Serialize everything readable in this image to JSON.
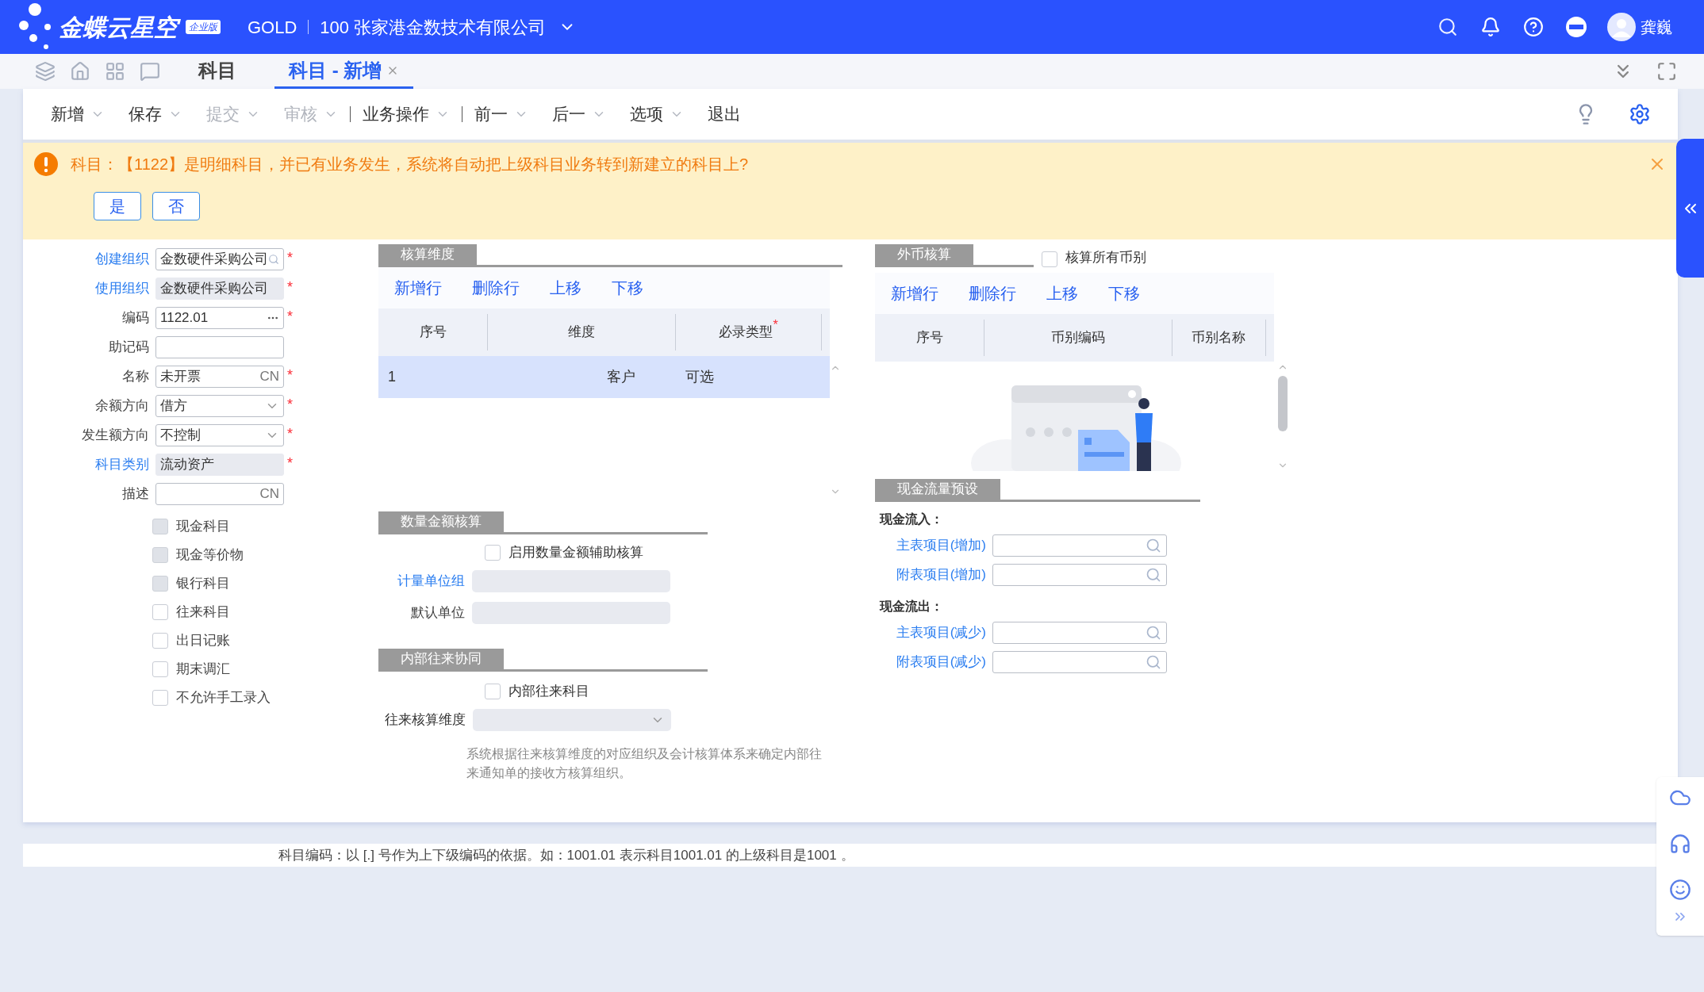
{
  "header": {
    "logo_text": "金蝶云星空",
    "edition_badge": "企业版",
    "product": "GOLD",
    "company": "100 张家港金数技术有限公司",
    "user": "龚巍"
  },
  "tabs": [
    {
      "label": "科目",
      "selected": false,
      "closable": false
    },
    {
      "label": "科目 - 新增",
      "selected": true,
      "closable": true
    }
  ],
  "toolbar": [
    {
      "label": "新增",
      "disabled": false,
      "dropdown": true,
      "separator_after": false
    },
    {
      "label": "保存",
      "disabled": false,
      "dropdown": true,
      "separator_after": false
    },
    {
      "label": "提交",
      "disabled": true,
      "dropdown": true,
      "separator_after": false
    },
    {
      "label": "审核",
      "disabled": true,
      "dropdown": true,
      "separator_after": true
    },
    {
      "label": "业务操作",
      "disabled": false,
      "dropdown": true,
      "separator_after": true
    },
    {
      "label": "前一",
      "disabled": false,
      "dropdown": true,
      "separator_after": false
    },
    {
      "label": "后一",
      "disabled": false,
      "dropdown": true,
      "separator_after": false
    },
    {
      "label": "选项",
      "disabled": false,
      "dropdown": true,
      "separator_after": false
    },
    {
      "label": "退出",
      "disabled": false,
      "dropdown": false,
      "separator_after": false
    }
  ],
  "alert": {
    "message": "科目：【1122】是明细科目，并已有业务发生，系统将自动把上级科目业务转到新建立的科目上?",
    "buttons": [
      "是",
      "否"
    ]
  },
  "form": {
    "fields": [
      {
        "label": "创建组织",
        "value": "金数硬件采购公司",
        "kind": "search",
        "required": true,
        "link": true,
        "readonly": false
      },
      {
        "label": "使用组织",
        "value": "金数硬件采购公司",
        "kind": "text",
        "required": true,
        "link": true,
        "readonly": true
      },
      {
        "label": "编码",
        "value": "1122.01",
        "kind": "ellipsis",
        "required": true,
        "link": false,
        "readonly": false
      },
      {
        "label": "助记码",
        "kind": "text",
        "required": false,
        "link": false,
        "readonly": false
      },
      {
        "label": "名称",
        "value": "未开票",
        "kind": "lang",
        "suffix": "CN",
        "required": true,
        "link": false,
        "readonly": false
      },
      {
        "label": "余额方向",
        "value": "借方",
        "kind": "dropdown",
        "required": true,
        "link": false,
        "readonly": false
      },
      {
        "label": "发生额方向",
        "value": "不控制",
        "kind": "dropdown",
        "required": true,
        "link": false,
        "readonly": false
      },
      {
        "label": "科目类别",
        "value": "流动资产",
        "kind": "text",
        "required": true,
        "link": true,
        "readonly": true
      },
      {
        "label": "描述",
        "kind": "lang",
        "suffix": "CN",
        "required": false,
        "link": false,
        "readonly": false
      }
    ],
    "checkboxes": [
      {
        "label": "现金科目",
        "checked": false,
        "disabled": true
      },
      {
        "label": "现金等价物",
        "checked": false,
        "disabled": true
      },
      {
        "label": "银行科目",
        "checked": false,
        "disabled": true
      },
      {
        "label": "往来科目",
        "checked": false,
        "disabled": false
      },
      {
        "label": "出日记账",
        "checked": false,
        "disabled": false
      },
      {
        "label": "期末调汇",
        "checked": false,
        "disabled": false
      },
      {
        "label": "不允许手工录入",
        "checked": false,
        "disabled": false
      }
    ]
  },
  "dimensions": {
    "title": "核算维度",
    "actions": [
      "新增行",
      "删除行",
      "上移",
      "下移"
    ],
    "columns": [
      {
        "label": "序号",
        "required": false
      },
      {
        "label": "维度",
        "required": false
      },
      {
        "label": "必录类型",
        "required": true
      }
    ],
    "rows": [
      {
        "cells": [
          "1",
          "客户",
          "可选"
        ],
        "selected": true
      }
    ]
  },
  "currency": {
    "title": "外币核算",
    "all_currencies": {
      "label": "核算所有币别",
      "checked": false
    },
    "actions": [
      "新增行",
      "删除行",
      "上移",
      "下移"
    ],
    "columns": [
      {
        "label": "序号",
        "required": false
      },
      {
        "label": "币别编码",
        "required": false
      },
      {
        "label": "币别名称",
        "required": false
      }
    ]
  },
  "quantity": {
    "title": "数量金额核算",
    "enable": {
      "label": "启用数量金额辅助核算",
      "checked": false
    },
    "fields": [
      {
        "label": "计量单位组",
        "link": true
      },
      {
        "label": "默认单位",
        "link": false
      }
    ]
  },
  "internal": {
    "title": "内部往来协同",
    "checkbox": {
      "label": "内部往来科目",
      "checked": false
    },
    "field": {
      "label": "往来核算维度"
    },
    "note": "系统根据往来核算维度的对应组织及会计核算体系来确定内部往来通知单的接收方核算组织。"
  },
  "cashflow": {
    "title": "现金流量预设",
    "groups": [
      {
        "heading": "现金流入：",
        "fields": [
          {
            "label": "主表项目(增加)"
          },
          {
            "label": "附表项目(增加)"
          }
        ]
      },
      {
        "heading": "现金流出：",
        "fields": [
          {
            "label": "主表项目(减少)"
          },
          {
            "label": "附表项目(减少)"
          }
        ]
      }
    ]
  },
  "required_mark": "*",
  "footer_hint": "科目编码：以 [.] 号作为上下级编码的依据。如：1001.01 表示科目1001.01 的上级科目是1001 。"
}
